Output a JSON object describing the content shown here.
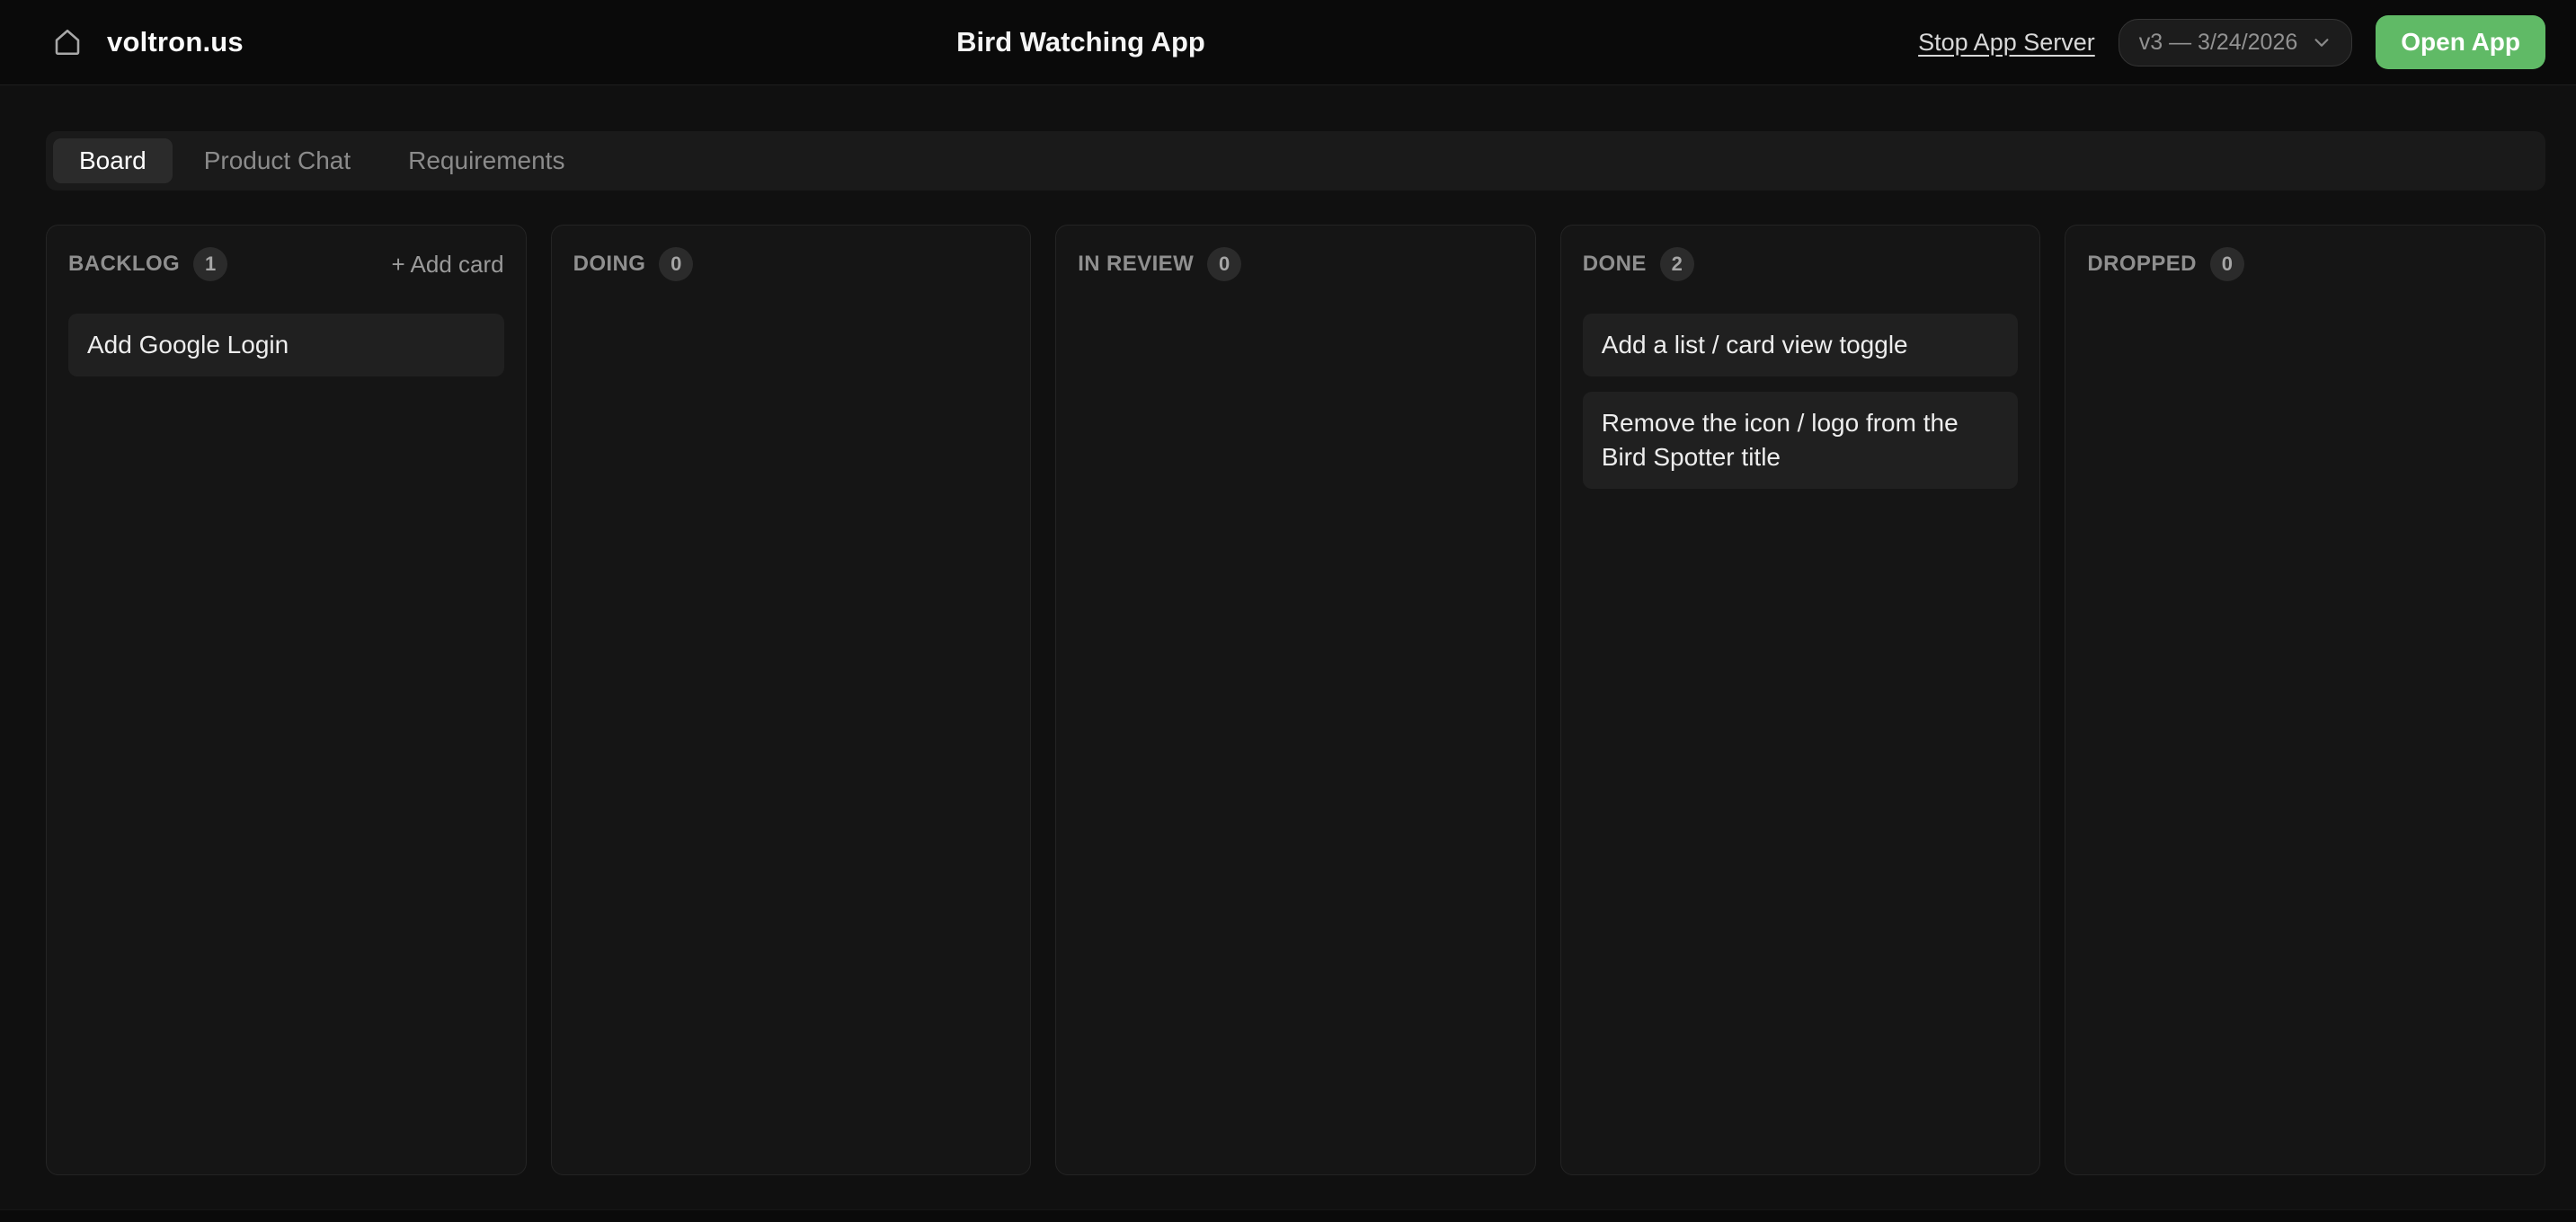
{
  "topbar": {
    "logo_text": "voltron.us",
    "app_title": "Bird Watching App",
    "stop_server_label": "Stop App Server",
    "version_label": "v3 — 3/24/2026",
    "open_app_label": "Open App"
  },
  "tabs": {
    "board": "Board",
    "product_chat": "Product Chat",
    "requirements": "Requirements"
  },
  "board": {
    "columns": [
      {
        "name": "BACKLOG",
        "count": "1",
        "add_card_label": "+ Add card",
        "cards": [
          "Add Google Login"
        ]
      },
      {
        "name": "DOING",
        "count": "0",
        "cards": []
      },
      {
        "name": "IN REVIEW",
        "count": "0",
        "cards": []
      },
      {
        "name": "DONE",
        "count": "2",
        "cards": [
          "Add a list / card view toggle",
          "Remove the icon / logo from the Bird Spotter title"
        ]
      },
      {
        "name": "DROPPED",
        "count": "0",
        "cards": []
      }
    ]
  },
  "colors": {
    "accent_green": "#60ba66",
    "topbar_bg": "#0a0a0a",
    "column_bg": "#151515",
    "card_bg": "#202020"
  }
}
